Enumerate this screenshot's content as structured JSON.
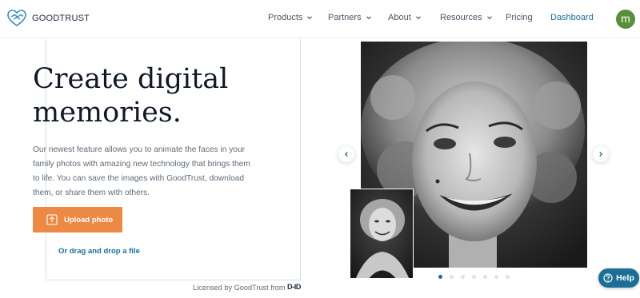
{
  "header": {
    "brand": "GOODTRUST",
    "nav": [
      {
        "label": "Products",
        "icon": "chevron-down-icon"
      },
      {
        "label": "Partners",
        "icon": "chevron-down-icon"
      },
      {
        "label": "About",
        "icon": "chevron-down-icon"
      },
      {
        "label": "Resources",
        "icon": "chevron-down-icon"
      },
      {
        "label": "Pricing"
      },
      {
        "label": "Dashboard"
      }
    ],
    "avatar_initial": "m"
  },
  "hero": {
    "title_line1": "Create digital",
    "title_line2": "memories.",
    "description": "Our newest feature allows you to animate the faces in your family photos with amazing new technology that brings them to life. You can save the images with GoodTrust, download them, or share them with others.",
    "upload_label": "Upload photo",
    "upload_icon": "upload-icon",
    "drag_label": "Or drag and drop a file",
    "license_text": "Licensed by GoodTrust from",
    "license_brand": "D-ID"
  },
  "carousel": {
    "slide_count": 7,
    "active_index": 0,
    "prev_icon": "chevron-left-icon",
    "next_icon": "chevron-right-icon"
  },
  "help": {
    "label": "Help",
    "icon": "help-circle-icon"
  },
  "colors": {
    "accent_blue": "#1b6f95",
    "upload_orange": "#ec8a45",
    "avatar_green": "#5b8e3a"
  }
}
